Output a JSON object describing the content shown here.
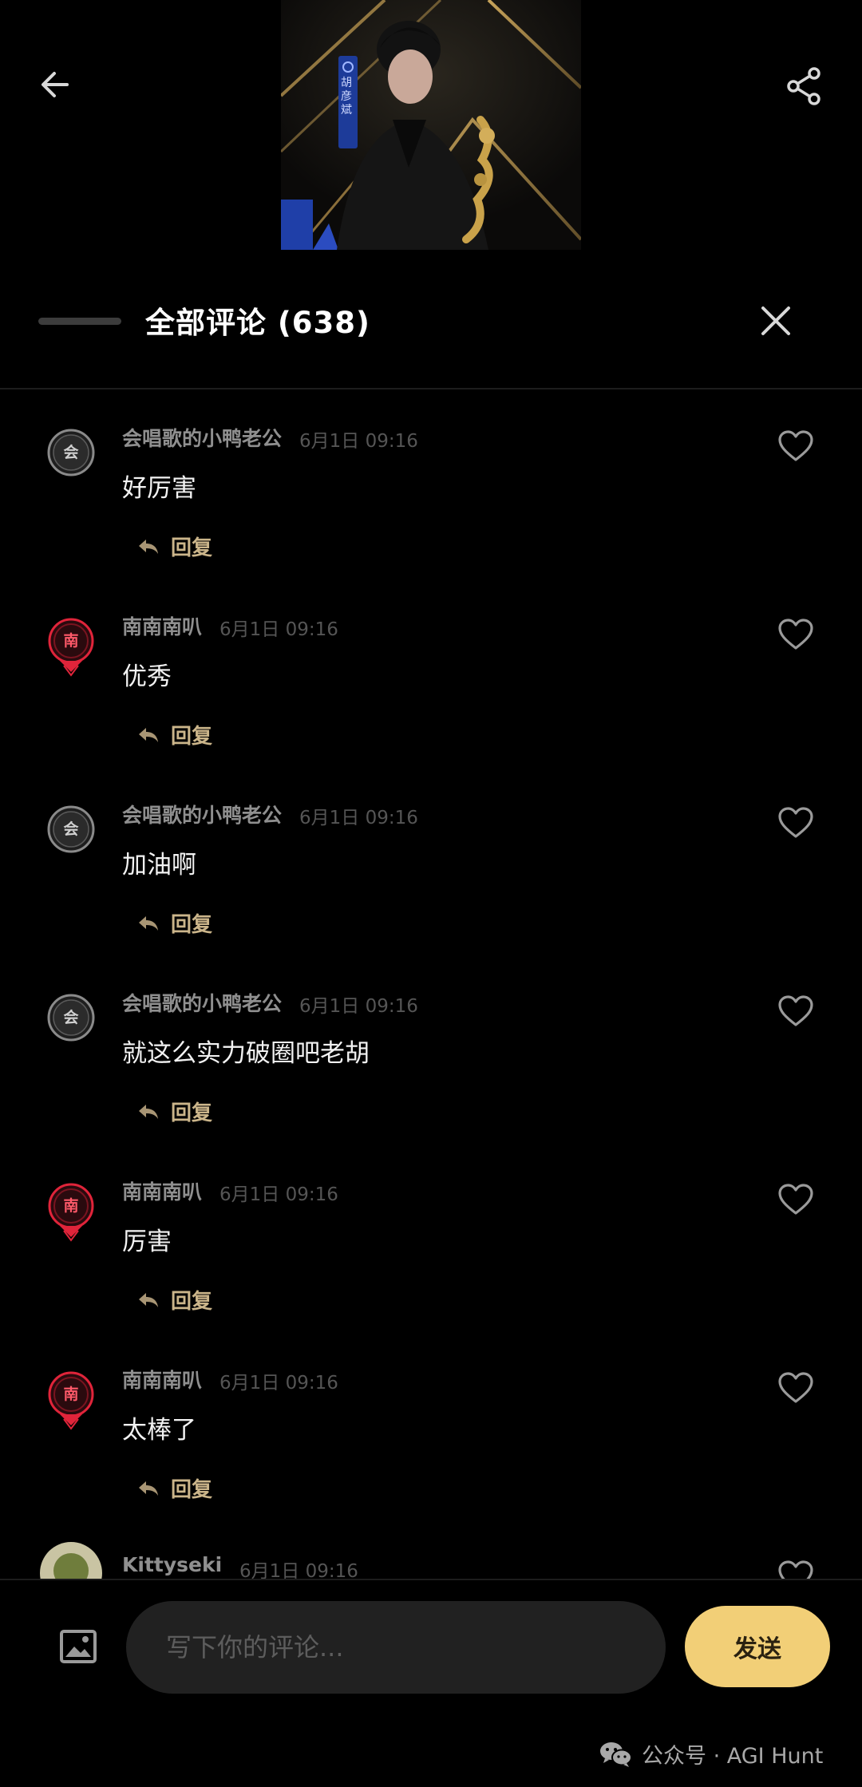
{
  "header": {
    "back_icon": "arrow-left-icon",
    "share_icon": "share-icon",
    "cover_tag": "胡彦斌"
  },
  "panel": {
    "title": "全部评论 (638)",
    "close_icon": "close-icon"
  },
  "comments": [
    {
      "name": "会唱歌的小鸭老公",
      "time": "6月1日 09:16",
      "text": "好厉害",
      "avatar_char": "会",
      "avatar_style": "gray",
      "reply_label": "回复"
    },
    {
      "name": "南南南叭",
      "time": "6月1日 09:16",
      "text": "优秀",
      "avatar_char": "南",
      "avatar_style": "red",
      "reply_label": "回复"
    },
    {
      "name": "会唱歌的小鸭老公",
      "time": "6月1日 09:16",
      "text": "加油啊",
      "avatar_char": "会",
      "avatar_style": "gray",
      "reply_label": "回复"
    },
    {
      "name": "会唱歌的小鸭老公",
      "time": "6月1日 09:16",
      "text": "就这么实力破圈吧老胡",
      "avatar_char": "会",
      "avatar_style": "gray",
      "reply_label": "回复"
    },
    {
      "name": "南南南叭",
      "time": "6月1日 09:16",
      "text": "厉害",
      "avatar_char": "南",
      "avatar_style": "red",
      "reply_label": "回复"
    },
    {
      "name": "南南南叭",
      "time": "6月1日 09:16",
      "text": "太棒了",
      "avatar_char": "南",
      "avatar_style": "red",
      "reply_label": "回复"
    },
    {
      "name": "Kittyseki",
      "time": "6月1日 09:16",
      "text": "",
      "avatar_char": "",
      "avatar_style": "photo",
      "reply_label": ""
    }
  ],
  "composer": {
    "image_icon": "image-icon",
    "placeholder": "写下你的评论...",
    "send_label": "发送"
  },
  "watermark": {
    "icon": "wechat-icon",
    "text": "公众号 · AGI Hunt"
  },
  "colors": {
    "background": "#000000",
    "accent_gold": "#f2cf77",
    "reply_gold": "#cbb58a",
    "badge_red": "#e0243a"
  }
}
